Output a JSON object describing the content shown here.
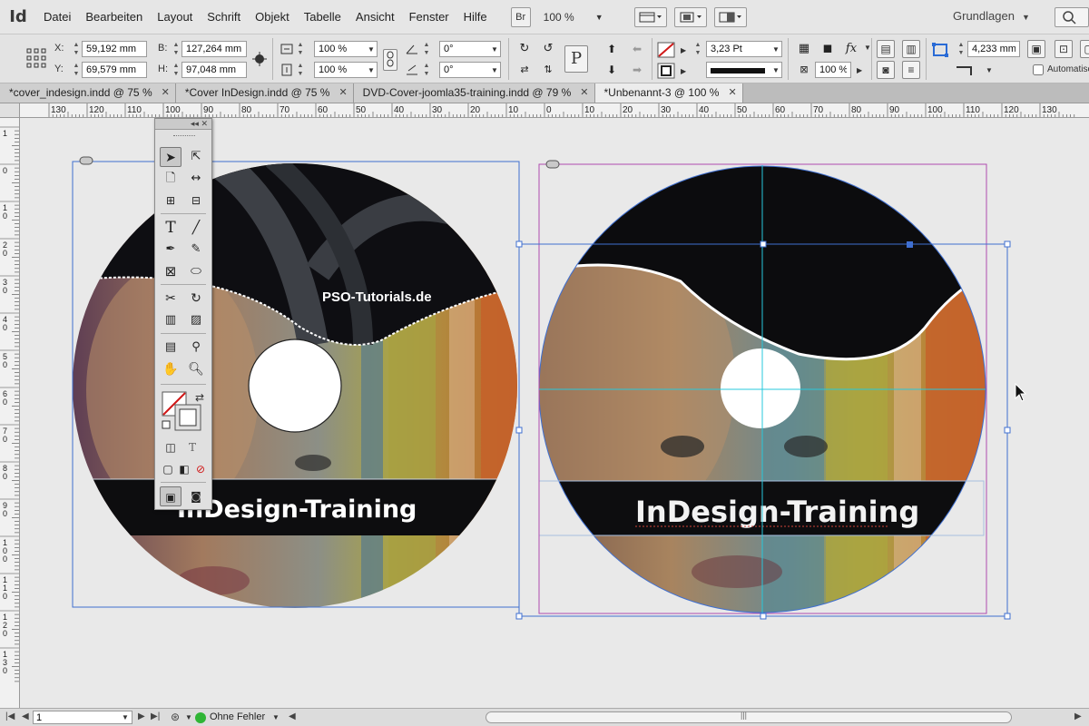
{
  "app": {
    "logo": "Id"
  },
  "menu": {
    "items": [
      "Datei",
      "Bearbeiten",
      "Layout",
      "Schrift",
      "Objekt",
      "Tabelle",
      "Ansicht",
      "Fenster",
      "Hilfe"
    ]
  },
  "menubar": {
    "bridge_label": "Br",
    "zoom": "100 %",
    "workspace": "Grundlagen"
  },
  "control_panel": {
    "x_label": "X:",
    "x_value": "59,192 mm",
    "y_label": "Y:",
    "y_value": "69,579 mm",
    "w_label": "B:",
    "w_value": "127,264 mm",
    "h_label": "H:",
    "h_value": "97,048 mm",
    "scale_x": "100 %",
    "scale_y": "100 %",
    "rotate": "0°",
    "shear": "0°",
    "stroke_weight": "3,23 Pt",
    "opacity": "100 %",
    "offset": "4,233 mm",
    "autofit_label": "Automatisch"
  },
  "tabs": [
    {
      "label": "*cover_indesign.indd @ 75 %",
      "active": false
    },
    {
      "label": "*Cover InDesign.indd @ 75 %",
      "active": false
    },
    {
      "label": "DVD-Cover-joomla35-training.indd @ 79 %",
      "active": false
    },
    {
      "label": "*Unbenannt-3 @ 100 %",
      "active": true
    }
  ],
  "ruler_top": [
    "130",
    "120",
    "110",
    "100",
    "90",
    "80",
    "70",
    "60",
    "50",
    "40",
    "30",
    "20",
    "10",
    "0",
    "10",
    "20",
    "30",
    "40",
    "50",
    "60",
    "70",
    "80",
    "90",
    "100",
    "110",
    "120",
    "130"
  ],
  "ruler_left": [
    "1",
    "0",
    "1 0",
    "2 0",
    "3 0",
    "4 0",
    "5 0",
    "6 0",
    "7 0",
    "8 0",
    "9 0",
    "1 0 0",
    "1 1 0",
    "1 2 0",
    "1 3 0"
  ],
  "canvas": {
    "left_cd": {
      "brand": "PSO-Tutorials.de",
      "title": "InDesign-Training"
    },
    "right_cd": {
      "title": "InDesign-Training"
    },
    "colors": {
      "frame_blue": "#3f6fd0",
      "frame_magenta": "#b04cb0",
      "guide_cyan": "#27c8dc",
      "black_band": "#0d0d0f"
    }
  },
  "toolbox": {
    "tools": [
      "selection",
      "direct-selection",
      "page",
      "gap",
      "content-collector",
      "content-placer",
      "type",
      "line",
      "pen",
      "pencil",
      "rectangle-frame",
      "ellipse",
      "scissors",
      "free-transform",
      "gradient-swatch",
      "gradient-feather",
      "note",
      "eyedropper",
      "hand",
      "zoom"
    ]
  },
  "status": {
    "page": "1",
    "preflight": "Ohne Fehler"
  }
}
